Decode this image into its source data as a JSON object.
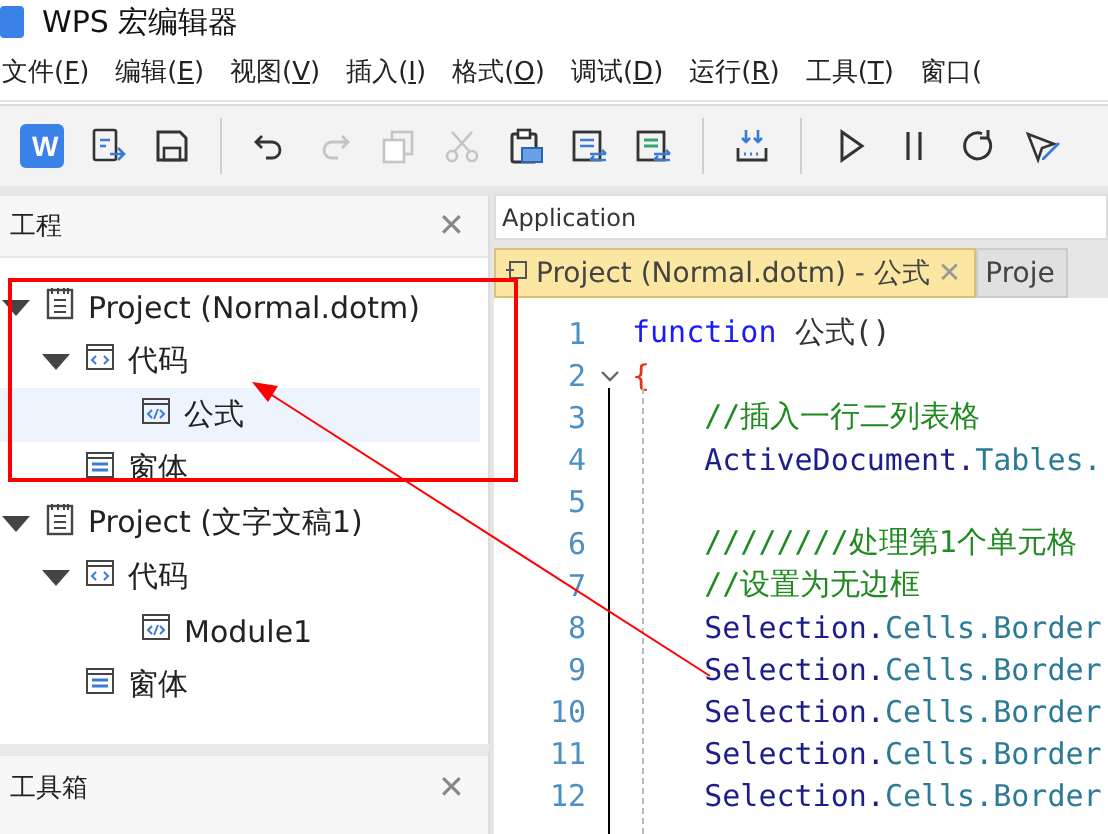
{
  "window": {
    "title": "WPS 宏编辑器"
  },
  "menu": [
    {
      "before": "文件(",
      "key": "F",
      "after": ")"
    },
    {
      "before": "编辑(",
      "key": "E",
      "after": ")"
    },
    {
      "before": "视图(",
      "key": "V",
      "after": ")"
    },
    {
      "before": "插入(",
      "key": "I",
      "after": ")"
    },
    {
      "before": "格式(",
      "key": "O",
      "after": ")"
    },
    {
      "before": "调试(",
      "key": "D",
      "after": ")"
    },
    {
      "before": "运行(",
      "key": "R",
      "after": ")"
    },
    {
      "before": "工具(",
      "key": "T",
      "after": ")"
    },
    {
      "before": "窗口("
    }
  ],
  "toolbar": [
    {
      "kind": "logo",
      "label": "W",
      "disabled": false
    },
    {
      "kind": "export",
      "disabled": false
    },
    {
      "kind": "save",
      "disabled": false
    },
    {
      "kind": "separator"
    },
    {
      "kind": "undo",
      "disabled": false
    },
    {
      "kind": "redo",
      "disabled": true
    },
    {
      "kind": "copy",
      "disabled": true
    },
    {
      "kind": "cut",
      "disabled": true
    },
    {
      "kind": "paste",
      "disabled": false
    },
    {
      "kind": "import",
      "disabled": false
    },
    {
      "kind": "export-list",
      "disabled": false
    },
    {
      "kind": "separator"
    },
    {
      "kind": "compile",
      "disabled": false
    },
    {
      "kind": "separator"
    },
    {
      "kind": "run",
      "disabled": false
    },
    {
      "kind": "pause",
      "disabled": false
    },
    {
      "kind": "reset",
      "disabled": false
    },
    {
      "kind": "design",
      "disabled": false
    }
  ],
  "project_panel": {
    "title": "工程",
    "close": "✕",
    "tree": [
      {
        "kind": "project",
        "label": "Project (Normal.dotm)",
        "expanded": true,
        "selected": false,
        "children": [
          {
            "kind": "folder-code",
            "label": "代码",
            "expanded": true,
            "selected": false,
            "children": [
              {
                "kind": "module",
                "label": "公式",
                "selected": true
              }
            ]
          },
          {
            "kind": "folder-form",
            "label": "窗体",
            "selected": false
          }
        ]
      },
      {
        "kind": "project",
        "label": "Project (文字文稿1)",
        "expanded": true,
        "selected": false,
        "children": [
          {
            "kind": "folder-code",
            "label": "代码",
            "expanded": true,
            "selected": false,
            "children": [
              {
                "kind": "module",
                "label": "Module1",
                "selected": false
              }
            ]
          },
          {
            "kind": "folder-form",
            "label": "窗体",
            "selected": false
          }
        ]
      }
    ]
  },
  "toolbox_panel": {
    "title": "工具箱",
    "close": "✕"
  },
  "editor": {
    "object_bar": "Application",
    "tabs": [
      {
        "label": "Project (Normal.dotm) - 公式",
        "close": "✕",
        "selected": true
      },
      {
        "label": "Proje",
        "selected": false
      }
    ],
    "lines": [
      {
        "number": "1",
        "tokens": [
          {
            "kind": "keyword",
            "text": "function"
          },
          {
            "kind": "plain",
            "text": " 公式()"
          }
        ]
      },
      {
        "number": "2",
        "expanded": true,
        "tokens": [
          {
            "kind": "brace",
            "text": "{"
          }
        ]
      },
      {
        "number": "3",
        "tokens": [
          {
            "kind": "comment",
            "text": "    //插入一行二列表格"
          }
        ]
      },
      {
        "number": "4",
        "tokens": [
          {
            "kind": "object",
            "text": "    ActiveDocument."
          },
          {
            "kind": "member",
            "text": "Tables."
          }
        ]
      },
      {
        "number": "5"
      },
      {
        "number": "6",
        "tokens": [
          {
            "kind": "comment",
            "text": "    ////////处理第1个单元格"
          }
        ]
      },
      {
        "number": "7",
        "tokens": [
          {
            "kind": "comment",
            "text": "    //设置为无边框"
          }
        ]
      },
      {
        "number": "8",
        "tokens": [
          {
            "kind": "object",
            "text": "    Selection."
          },
          {
            "kind": "member",
            "text": "Cells.Border"
          }
        ]
      },
      {
        "number": "9",
        "tokens": [
          {
            "kind": "object",
            "text": "    Selection."
          },
          {
            "kind": "member",
            "text": "Cells.Border"
          }
        ]
      },
      {
        "number": "10",
        "tokens": [
          {
            "kind": "object",
            "text": "    Selection."
          },
          {
            "kind": "member",
            "text": "Cells.Border"
          }
        ]
      },
      {
        "number": "11",
        "tokens": [
          {
            "kind": "object",
            "text": "    Selection."
          },
          {
            "kind": "member",
            "text": "Cells.Border"
          }
        ]
      },
      {
        "number": "12",
        "tokens": [
          {
            "kind": "object",
            "text": "    Selection."
          },
          {
            "kind": "member",
            "text": "Cells.Border"
          }
        ]
      }
    ]
  }
}
